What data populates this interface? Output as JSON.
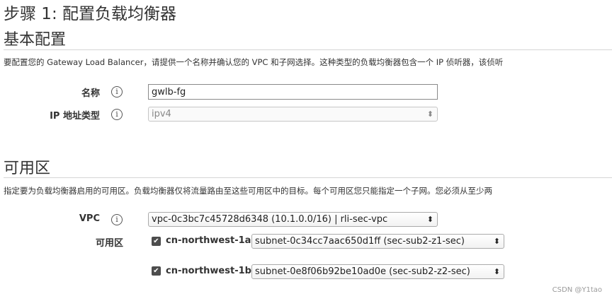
{
  "step_title": "步骤 1: 配置负载均衡器",
  "basic": {
    "title": "基本配置",
    "description": "要配置您的 Gateway Load Balancer，请提供一个名称并确认您的 VPC 和子网选择。这种类型的负载均衡器包含一个 IP 侦听器，该侦听",
    "name_label": "名称",
    "name_value": "gwlb-fg",
    "ip_type_label": "IP 地址类型",
    "ip_type_value": "ipv4"
  },
  "az": {
    "title": "可用区",
    "description": "指定要为负载均衡器启用的可用区。负载均衡器仅将流量路由至这些可用区中的目标。每个可用区您只能指定一个子网。您必须从至少两",
    "vpc_label": "VPC",
    "vpc_value": "vpc-0c3bc7c45728d6348 (10.1.0.0/16) | rli-sec-vpc",
    "zones_label": "可用区",
    "zones": [
      {
        "checked": true,
        "name": "cn-northwest-1a",
        "subnet": "subnet-0c34cc7aac650d1ff (sec-sub2-z1-sec)"
      },
      {
        "checked": true,
        "name": "cn-northwest-1b",
        "subnet": "subnet-0e8f06b92be10ad0e (sec-sub2-z2-sec)"
      }
    ]
  },
  "icons": {
    "info": "info-icon",
    "select_arrow": "updown-arrow-icon",
    "check": "checkmark-icon"
  },
  "watermark": "CSDN @Y1tao"
}
